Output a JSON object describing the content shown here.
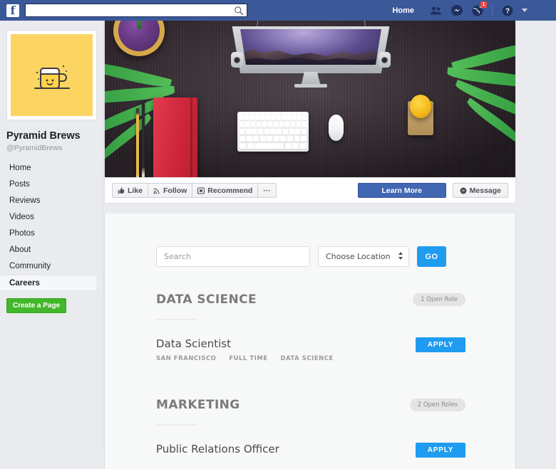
{
  "topbar": {
    "logo_glyph": "f",
    "search_placeholder": "",
    "search_value": "",
    "home_label": "Home",
    "notification_count": "1",
    "icons": [
      "friends-icon",
      "messenger-icon",
      "globe-notifications-icon",
      "help-icon",
      "account-caret-icon"
    ]
  },
  "sidebar": {
    "page_name": "Pyramid Brews",
    "page_handle": "@PyramidBrews",
    "items": [
      {
        "label": "Home",
        "active": false
      },
      {
        "label": "Posts",
        "active": false
      },
      {
        "label": "Reviews",
        "active": false
      },
      {
        "label": "Videos",
        "active": false
      },
      {
        "label": "Photos",
        "active": false
      },
      {
        "label": "About",
        "active": false
      },
      {
        "label": "Community",
        "active": false
      },
      {
        "label": "Careers",
        "active": true
      }
    ],
    "create_page_label": "Create a Page",
    "avatar_icon": "beer-mug-icon",
    "avatar_bg": "#fcd462"
  },
  "actionbar": {
    "like_label": "Like",
    "follow_label": "Follow",
    "recommend_label": "Recommend",
    "more_label": "···",
    "learn_more_label": "Learn More",
    "message_label": "Message",
    "primary_color": "#4267b2"
  },
  "careers": {
    "search_placeholder": "Search",
    "search_value": "",
    "location_selected": "Choose Location",
    "go_label": "GO",
    "accent_color": "#1f9bf0",
    "sections": [
      {
        "title": "DATA SCIENCE",
        "count_label": "1 Open Role",
        "jobs": [
          {
            "title": "Data Scientist",
            "meta": [
              "SAN FRANCISCO",
              "FULL TIME",
              "DATA SCIENCE"
            ],
            "apply_label": "APPLY"
          }
        ]
      },
      {
        "title": "MARKETING",
        "count_label": "2 Open Roles",
        "jobs": [
          {
            "title": "Public Relations Officer",
            "meta": [],
            "apply_label": "APPLY"
          }
        ]
      }
    ]
  }
}
